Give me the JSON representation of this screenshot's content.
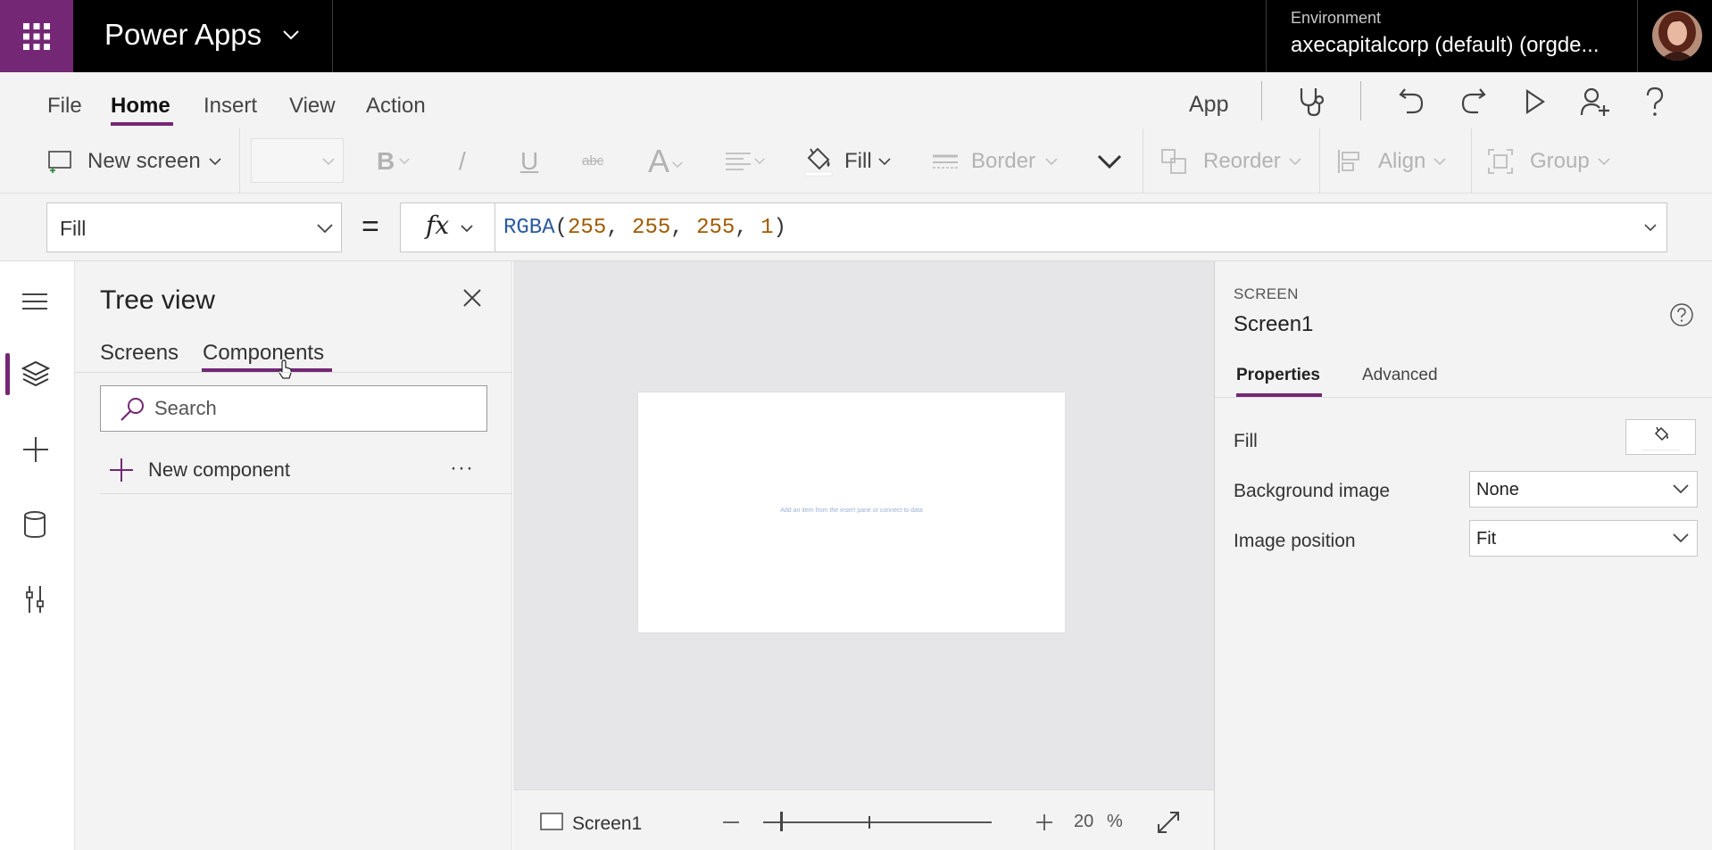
{
  "header": {
    "app_name": "Power Apps",
    "environment_label": "Environment",
    "environment_value": "axecapitalcorp (default) (orgde..."
  },
  "menu": {
    "items": [
      "File",
      "Home",
      "Insert",
      "View",
      "Action"
    ],
    "active": "Home",
    "app_label": "App"
  },
  "ribbon": {
    "new_screen": "New screen",
    "bold": "B",
    "italic": "/",
    "underline": "U",
    "strikethrough": "abc",
    "font_color": "A",
    "fill": "Fill",
    "border": "Border",
    "reorder": "Reorder",
    "align": "Align",
    "group": "Group"
  },
  "formula_bar": {
    "property": "Fill",
    "equals": "=",
    "fx": "fx",
    "formula_fn": "RGBA",
    "formula_open": "(",
    "formula_args": [
      "255",
      "255",
      "255",
      "1"
    ],
    "formula_sep": ", ",
    "formula_close": ")"
  },
  "tree_view": {
    "title": "Tree view",
    "tabs": [
      "Screens",
      "Components"
    ],
    "active_tab": "Components",
    "search_placeholder": "Search",
    "new_component": "New component",
    "more": "···"
  },
  "canvas": {
    "hint_text": "Add an item from the insert pane or connect to data",
    "screen_name": "Screen1",
    "zoom_value": "20",
    "zoom_unit": "%",
    "zoom_level": 0.38
  },
  "properties_panel": {
    "kind": "SCREEN",
    "name": "Screen1",
    "tabs": [
      "Properties",
      "Advanced"
    ],
    "active_tab": "Properties",
    "fill_label": "Fill",
    "fill_color": "#FFFFFF",
    "background_image_label": "Background image",
    "background_image_value": "None",
    "image_position_label": "Image position",
    "image_position_value": "Fit"
  },
  "colors": {
    "accent": "#742774",
    "header_bg": "#000000",
    "panel_bg": "#F3F3F3",
    "canvas_bg": "#E6E6E8"
  }
}
